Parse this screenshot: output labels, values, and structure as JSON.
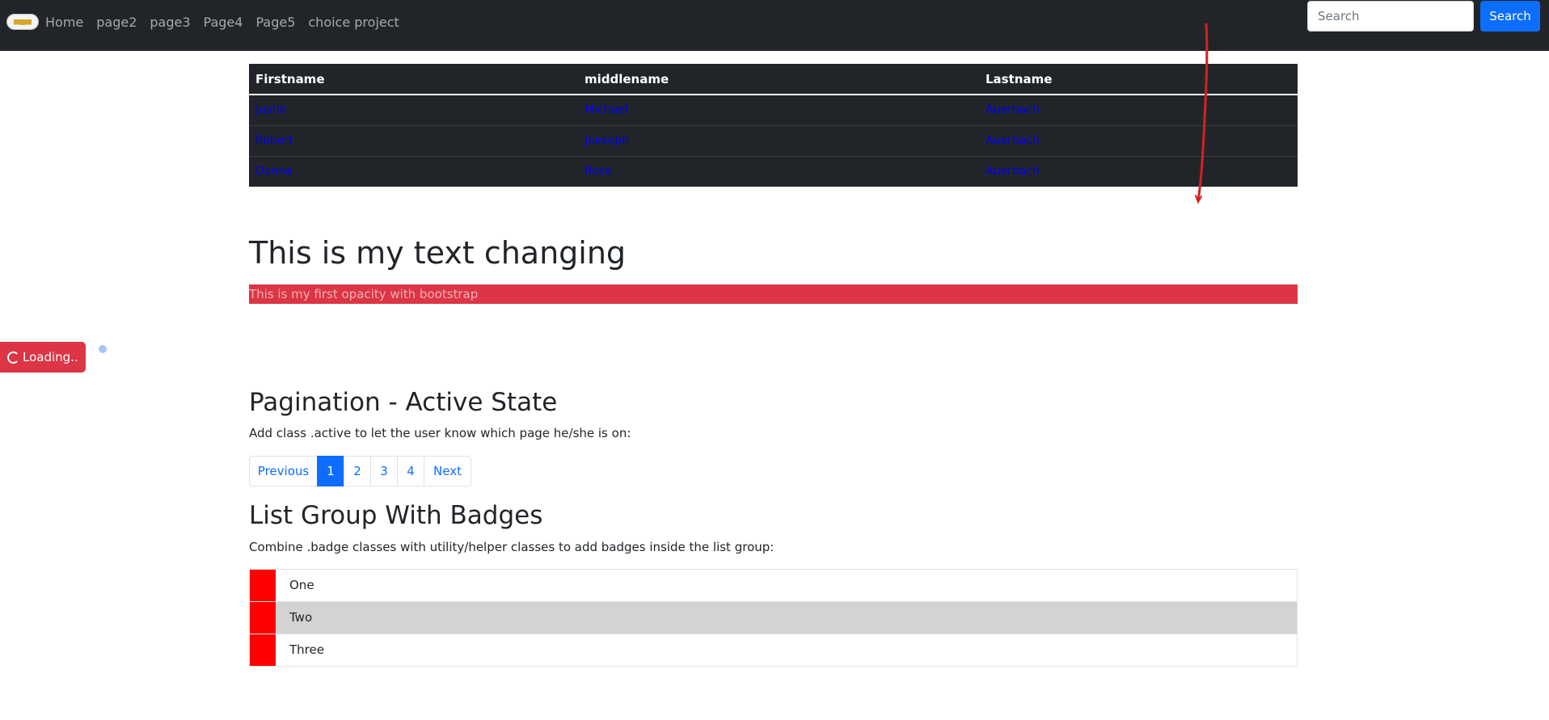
{
  "navbar": {
    "logo_icon": "chevrolet-bowtie-logo",
    "links": [
      "Home",
      "page2",
      "page3",
      "Page4",
      "Page5",
      "choice project"
    ],
    "search_placeholder": "Search",
    "search_button": "Search"
  },
  "table": {
    "headers": [
      "Firstname",
      "middlename",
      "Lastname"
    ],
    "rows": [
      [
        "Justin",
        "Michael",
        "Auerbach"
      ],
      [
        "Robert",
        "Joeseph",
        "Auerbach"
      ],
      [
        "Donna",
        "Rose",
        "Auerbach"
      ]
    ],
    "link_color": "#0000ee"
  },
  "main": {
    "heading": "This is my text changing",
    "opacity_text": "This is my first opacity with bootstrap"
  },
  "loading": {
    "label": "Loading..",
    "spinner_icon": "spinner-border-icon",
    "grow_icon": "spinner-grow-dot"
  },
  "pagination_section": {
    "title": "Pagination - Active State",
    "description": "Add class .active to let the user know which page he/she is on:",
    "items": [
      "Previous",
      "1",
      "2",
      "3",
      "4",
      "Next"
    ],
    "active": "1"
  },
  "list_section": {
    "title": "List Group With Badges",
    "description": "Combine .badge classes with utility/helper classes to add badges inside the list group:",
    "items": [
      "One",
      "Two",
      "Three"
    ]
  },
  "colors": {
    "navbar_bg": "#212529",
    "primary": "#0d6efd",
    "danger": "#dc3545",
    "badge_red": "#ff0000",
    "highlight_gray": "#d3d3d3",
    "annotation_red": "#d42020"
  }
}
